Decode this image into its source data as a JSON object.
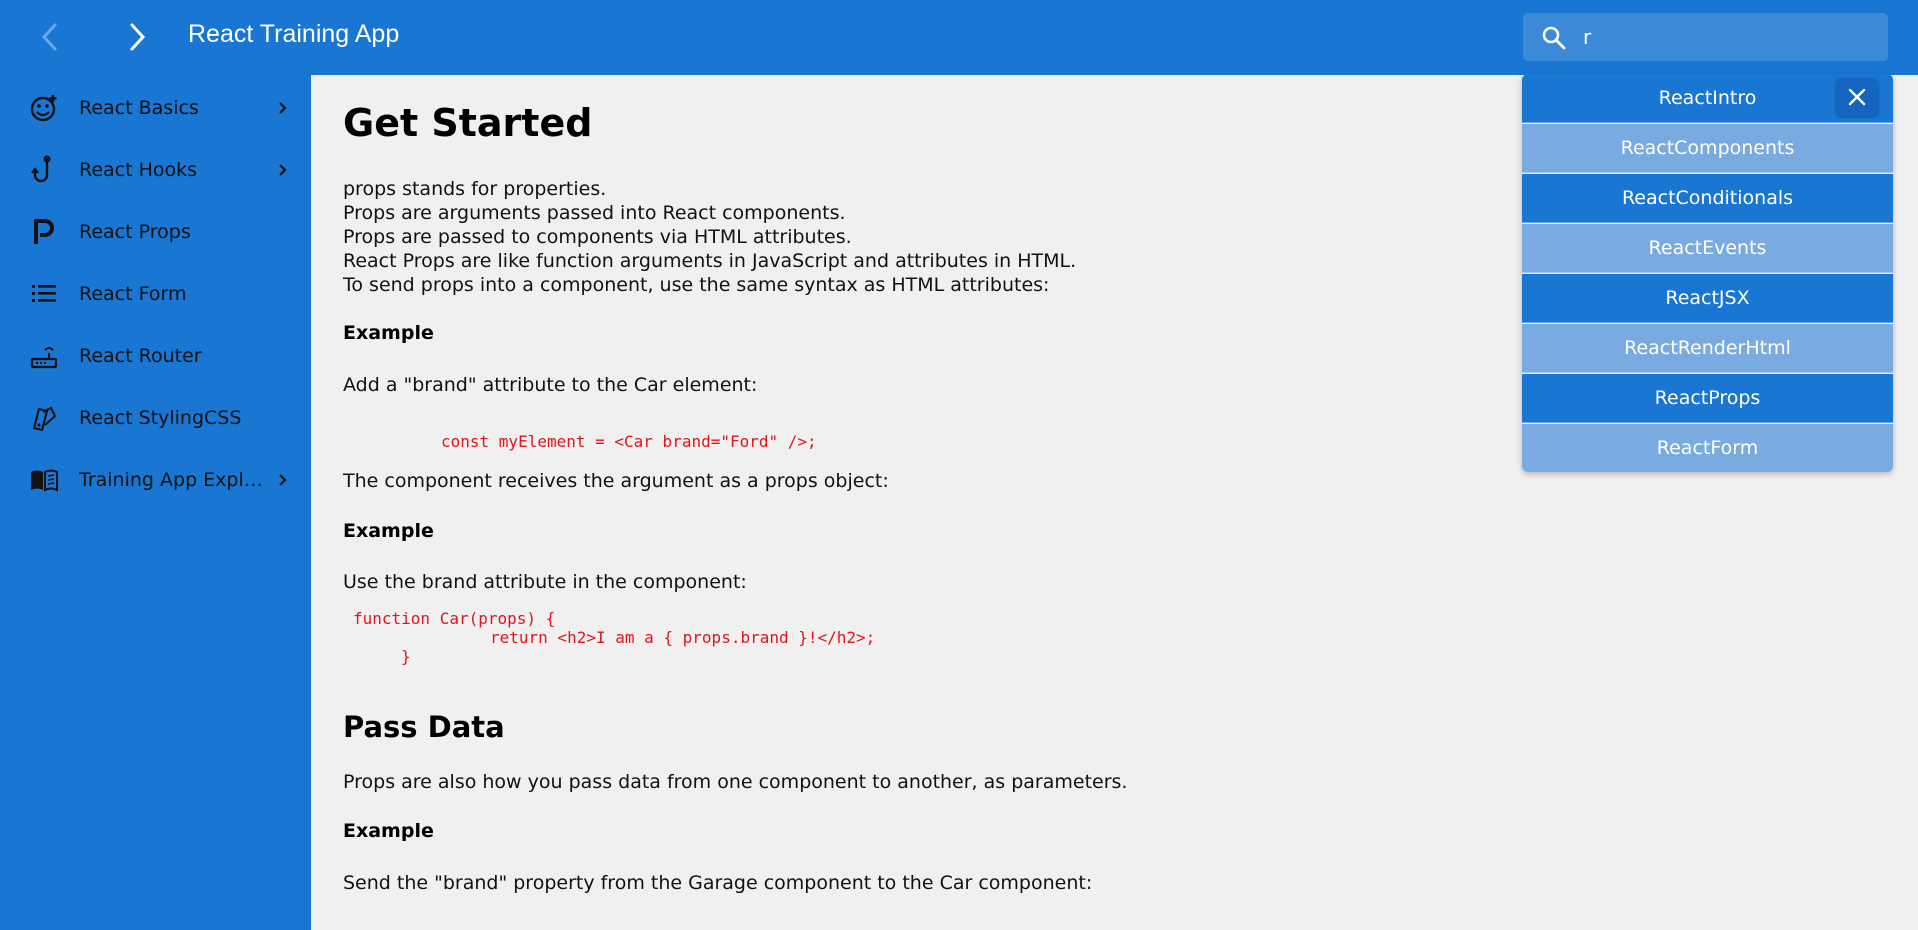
{
  "header": {
    "title": "React Training App",
    "search_value": "r"
  },
  "sidebar": {
    "items": [
      {
        "label": "React Basics",
        "icon": "smile-plus-icon",
        "has_chevron": true
      },
      {
        "label": "React Hooks",
        "icon": "hook-icon",
        "has_chevron": true
      },
      {
        "label": "React Props",
        "icon": "p-letter-icon",
        "has_chevron": false
      },
      {
        "label": "React Form",
        "icon": "list-icon",
        "has_chevron": false
      },
      {
        "label": "React Router",
        "icon": "router-icon",
        "has_chevron": false
      },
      {
        "label": "React StylingCSS",
        "icon": "swatch-icon",
        "has_chevron": false
      },
      {
        "label": "Training App Expla…",
        "icon": "book-icon",
        "has_chevron": true
      }
    ]
  },
  "main": {
    "title": "Get Started",
    "intro_lines": [
      "props stands for properties.",
      "Props are arguments passed into React components.",
      "Props are passed to components via HTML attributes.",
      "React Props are like function arguments in JavaScript and attributes in HTML.",
      "To send props into a component, use the same syntax as HTML attributes:"
    ],
    "example1_heading": "Example",
    "example1_text": "Add a \"brand\" attribute to the Car element:",
    "example1_code": "const myElement = <Car brand=\"Ford\" />;",
    "receives_text": "The component receives the argument as a props object:",
    "example2_heading": "Example",
    "example2_text": "Use the brand attribute in the component:",
    "example2_code_line1": "function Car(props) {",
    "example2_code_line2": "return <h2>I am a { props.brand }!</h2>;",
    "example2_code_line3": "}",
    "section2_title": "Pass Data",
    "section2_text": "Props are also how you pass data from one component to another, as parameters.",
    "example3_heading": "Example",
    "example3_text": "Send the \"brand\" property from the Garage component to the Car component:"
  },
  "dropdown": {
    "items": [
      "ReactIntro",
      "ReactComponents",
      "ReactConditionals",
      "ReactEvents",
      "ReactJSX",
      "ReactRenderHtml",
      "ReactProps",
      "ReactForm"
    ],
    "close_icon": "close-icon"
  },
  "colors": {
    "primary": "#1976d2",
    "dropdown_light": "#7aabe0",
    "code_red": "#e0161b",
    "background": "#f0f0f0"
  }
}
